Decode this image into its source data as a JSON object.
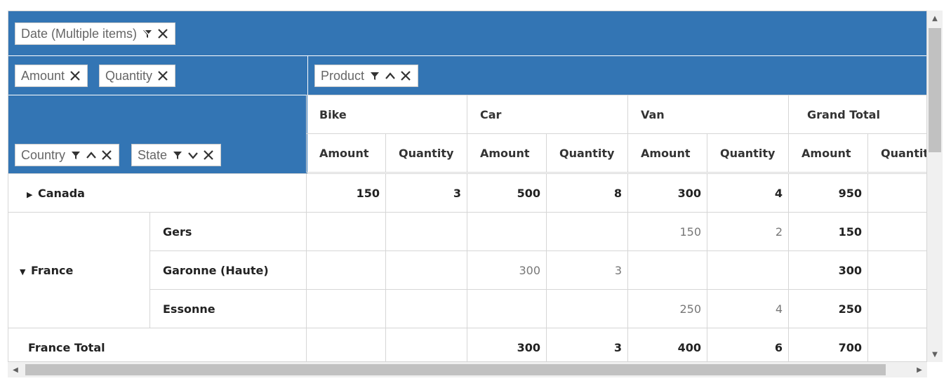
{
  "filter_area": {
    "chip_label": "Date (Multiple items)"
  },
  "value_area": {
    "chips": [
      "Amount",
      "Quantity"
    ]
  },
  "column_area": {
    "chip_label": "Product"
  },
  "row_area": {
    "chips": [
      "Country",
      "State"
    ]
  },
  "columns": {
    "products": [
      "Bike",
      "Car",
      "Van",
      "Grand Total"
    ],
    "measures": [
      "Amount",
      "Quantity",
      "Amount",
      "Quantity",
      "Amount",
      "Quantity",
      "Amount",
      "Quantity"
    ]
  },
  "rows": {
    "canada": {
      "label": "Canada",
      "values": [
        "150",
        "3",
        "500",
        "8",
        "300",
        "4",
        "950",
        ""
      ]
    },
    "france": {
      "label": "France",
      "states": [
        {
          "label": "Gers",
          "values": [
            "",
            "",
            "",
            "",
            "150",
            "2",
            "150",
            ""
          ]
        },
        {
          "label": "Garonne (Haute)",
          "values": [
            "",
            "",
            "300",
            "3",
            "",
            "",
            "300",
            ""
          ]
        },
        {
          "label": "Essonne",
          "values": [
            "",
            "",
            "",
            "",
            "250",
            "4",
            "250",
            ""
          ]
        }
      ]
    },
    "france_total": {
      "label": "France Total",
      "values": [
        "",
        "",
        "300",
        "3",
        "400",
        "6",
        "700",
        ""
      ]
    }
  },
  "colors": {
    "header_band": "#3375b4",
    "grid_line": "#d6d6d6"
  }
}
